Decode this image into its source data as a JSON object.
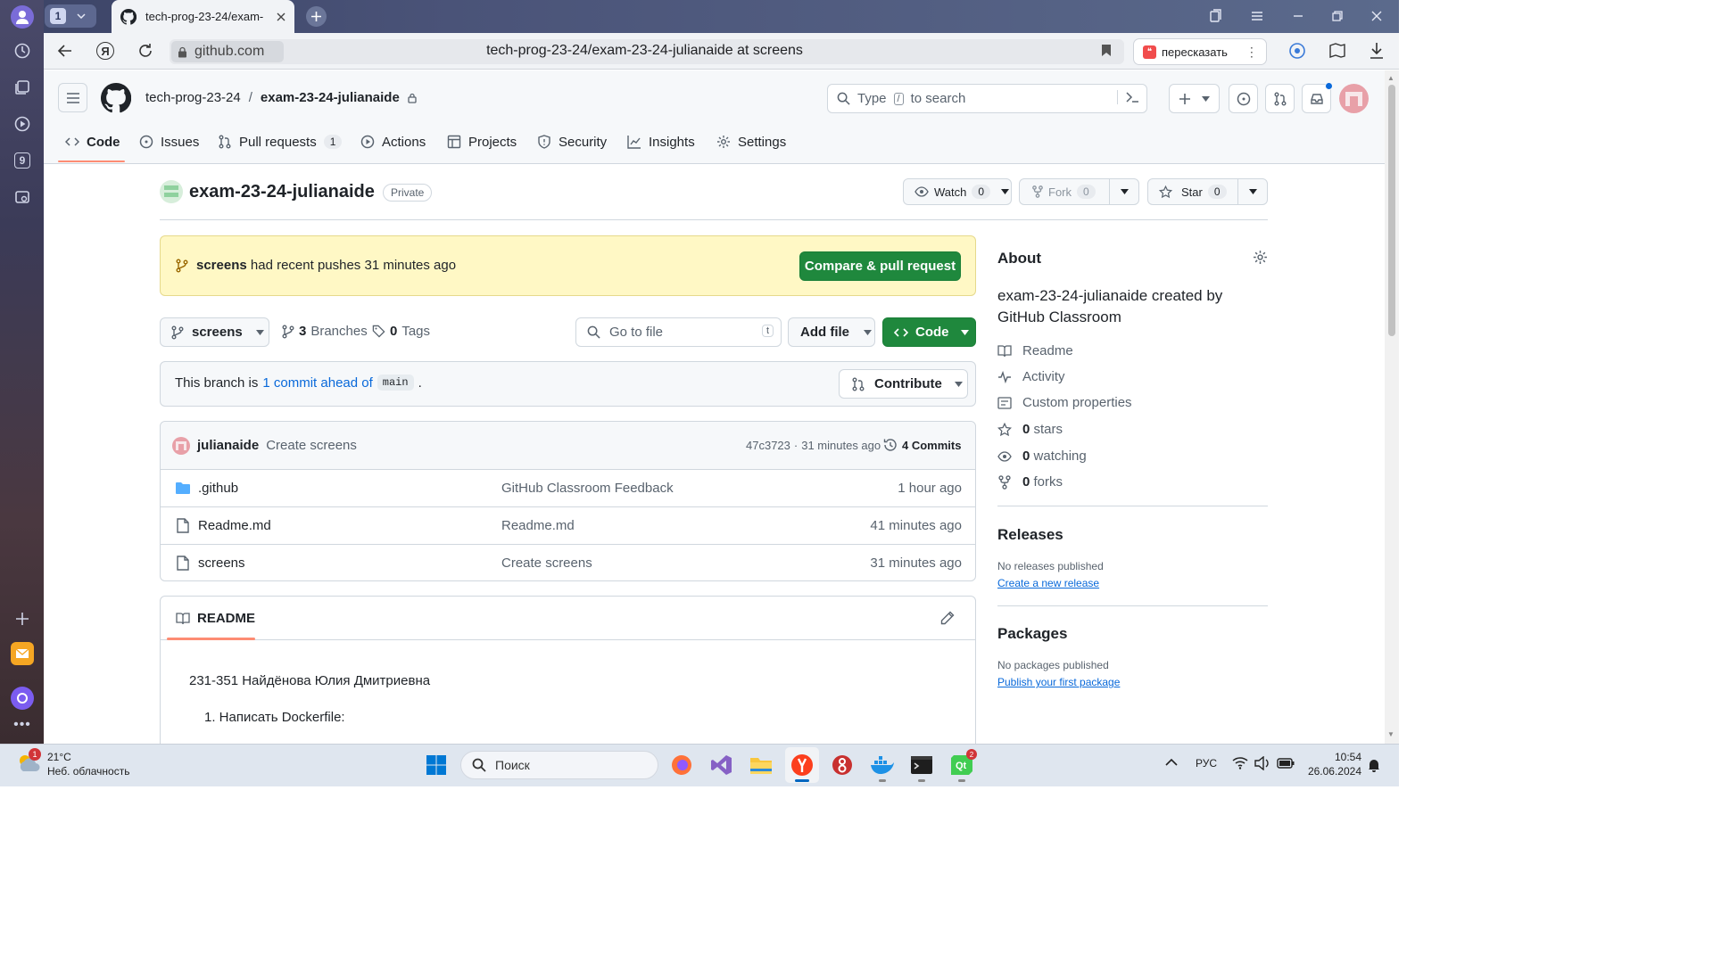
{
  "browser": {
    "tab_count": "1",
    "tab_title": "tech-prog-23-24/exam-",
    "domain": "github.com",
    "page_title": "tech-prog-23-24/exam-23-24-julianaide at screens",
    "retell_label": "пересказать"
  },
  "github": {
    "owner": "tech-prog-23-24",
    "separator": "/",
    "repo": "exam-23-24-julianaide",
    "search_placeholder": "Type / to search",
    "search_prefix": "Type",
    "search_key": "/",
    "search_suffix": "to search",
    "nav": [
      {
        "label": "Code"
      },
      {
        "label": "Issues"
      },
      {
        "label": "Pull requests",
        "count": "1"
      },
      {
        "label": "Actions"
      },
      {
        "label": "Projects"
      },
      {
        "label": "Security"
      },
      {
        "label": "Insights"
      },
      {
        "label": "Settings"
      }
    ],
    "repo_title": "exam-23-24-julianaide",
    "visibility": "Private",
    "watch": {
      "label": "Watch",
      "count": "0"
    },
    "fork": {
      "label": "Fork",
      "count": "0"
    },
    "star": {
      "label": "Star",
      "count": "0"
    },
    "banner": {
      "branch": "screens",
      "text": "had recent pushes 31 minutes ago",
      "button": "Compare & pull request"
    },
    "branch_select": "screens",
    "branches": "3 Branches",
    "branches_count": "3",
    "branches_word": "Branches",
    "tags_count": "0",
    "tags_word": "Tags",
    "goto_placeholder": "Go to file",
    "goto_key": "t",
    "add_file": "Add file",
    "code_button": "Code",
    "ahead": {
      "prefix": "This branch is",
      "link": "1 commit ahead of",
      "base": "main",
      "suffix": "."
    },
    "contribute": "Contribute",
    "latest_commit": {
      "author": "julianaide",
      "message": "Create screens",
      "hash": "47c3723",
      "sep": "·",
      "time": "31 minutes ago",
      "commits": "4 Commits"
    },
    "files": [
      {
        "name": ".github",
        "type": "folder",
        "message": "GitHub Classroom Feedback",
        "time": "1 hour ago"
      },
      {
        "name": "Readme.md",
        "type": "file",
        "message": "Readme.md",
        "time": "41 minutes ago"
      },
      {
        "name": "screens",
        "type": "file",
        "message": "Create screens",
        "time": "31 minutes ago"
      }
    ],
    "readme": {
      "tab": "README",
      "line1": "231-351 Найдёнова Юлия Дмитриевна",
      "line2": "1. Написать Dockerfile:"
    },
    "about": {
      "title": "About",
      "description": "exam-23-24-julianaide created by GitHub Classroom",
      "links": [
        "Readme",
        "Activity",
        "Custom properties"
      ],
      "stars": {
        "count": "0",
        "label": "stars"
      },
      "watching": {
        "count": "0",
        "label": "watching"
      },
      "forks": {
        "count": "0",
        "label": "forks"
      },
      "releases_title": "Releases",
      "releases_none": "No releases published",
      "releases_link": "Create a new release",
      "packages_title": "Packages",
      "packages_none": "No packages published",
      "packages_link": "Publish your first package"
    }
  },
  "taskbar": {
    "weather_temp": "21°C",
    "weather_desc": "Неб. облачность",
    "weather_badge": "1",
    "search": "Поиск",
    "lang": "РУС",
    "time": "10:54",
    "date": "26.06.2024",
    "qt_badge": "2"
  },
  "colors": {
    "accent": "#1f883d",
    "link": "#0969da",
    "tab_underline": "#fd8c73",
    "banner_bg": "#fff8c5"
  }
}
